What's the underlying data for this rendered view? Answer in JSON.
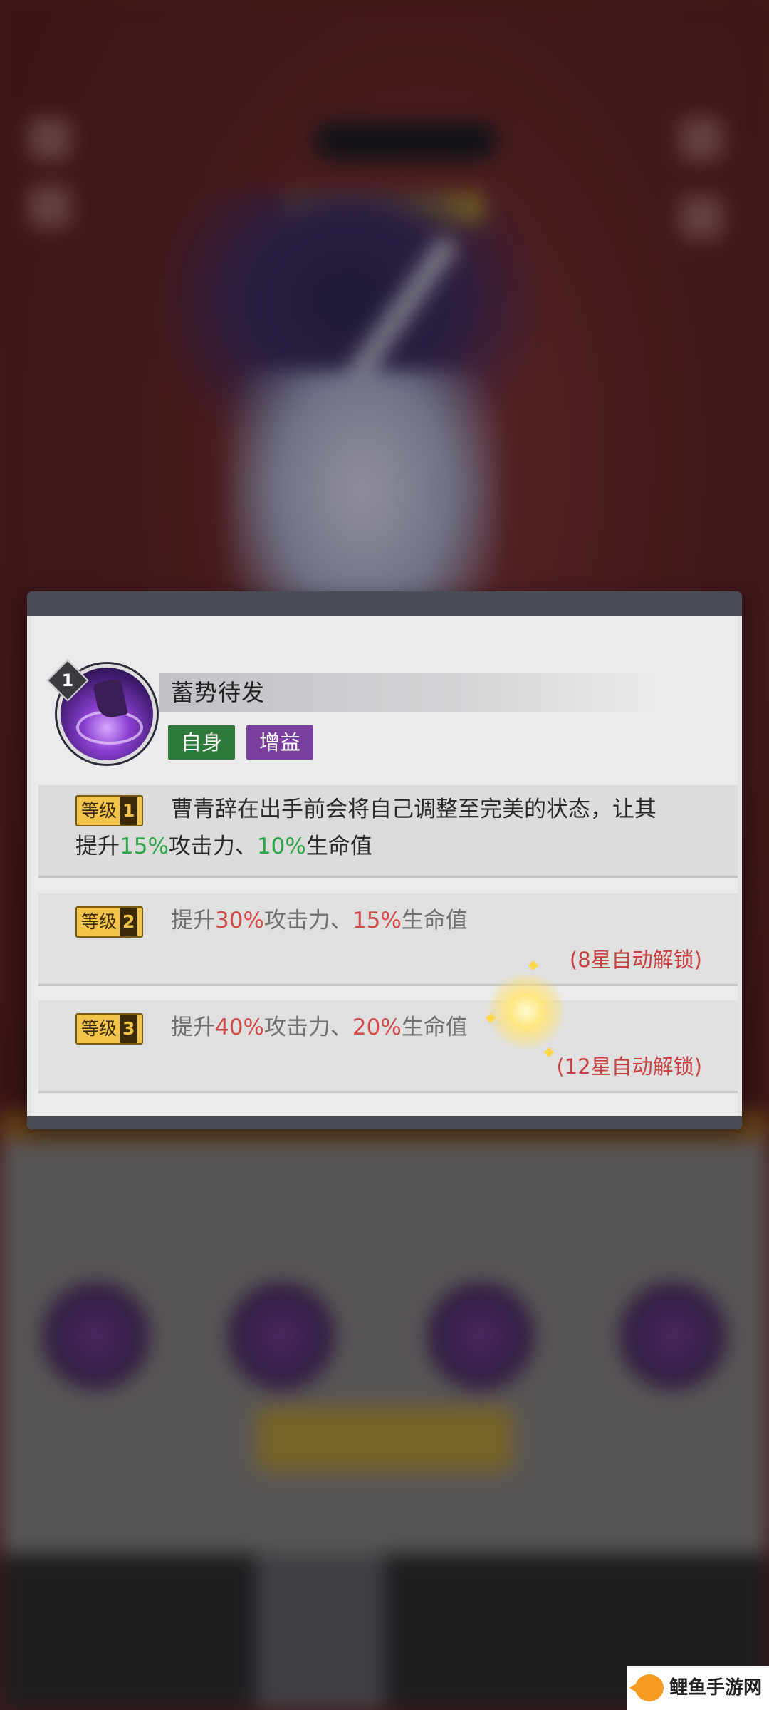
{
  "skill": {
    "level": "1",
    "name": "蓄势待发",
    "tags": [
      "自身",
      "增益"
    ],
    "levels": [
      {
        "badge_label": "等级",
        "badge_num": "1",
        "text_a": "曹青辞在出手前会将自己调整至完美的状态，让其",
        "text_b_prefix": "提升",
        "atk": "15%",
        "atk_label": "攻击力、",
        "hp": "10%",
        "hp_label": "生命值",
        "unlocked": true
      },
      {
        "badge_label": "等级",
        "badge_num": "2",
        "text_prefix": "提升",
        "atk": "30%",
        "atk_label": "攻击力、",
        "hp": "15%",
        "hp_label": "生命值",
        "unlock_note": "(8星自动解锁)",
        "unlocked": false
      },
      {
        "badge_label": "等级",
        "badge_num": "3",
        "text_prefix": "提升",
        "atk": "40%",
        "atk_label": "攻击力、",
        "hp": "20%",
        "hp_label": "生命值",
        "unlock_note": "(12星自动解锁)",
        "unlocked": false
      }
    ]
  },
  "watermark": {
    "text": "鲤鱼手游网"
  },
  "colors": {
    "tag_self": "#2f7a3a",
    "tag_buff": "#7a3f9c",
    "unlocked_value": "#2fa54a",
    "locked_value": "#d24a4a"
  }
}
